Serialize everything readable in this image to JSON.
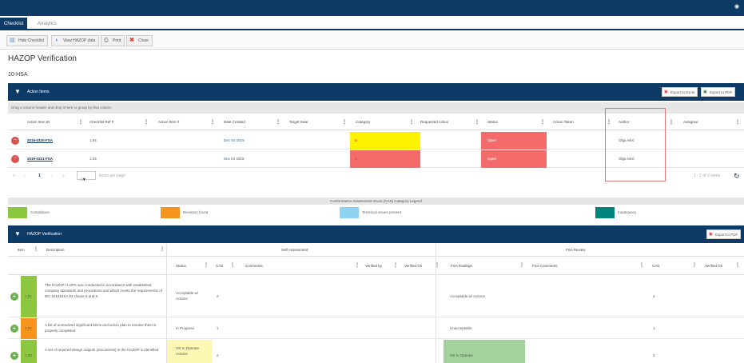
{
  "colors": {
    "navy": "#0e3a66",
    "yellow": "#fdf200",
    "red": "#f36b6b",
    "legend_green": "#8dc63f",
    "legend_orange": "#f7941d",
    "legend_blue": "#8fd3f2",
    "legend_teal": "#00857c",
    "item_green": "#8dc63f",
    "item_orange": "#f7941d",
    "light_yellow": "#fcf8b4",
    "light_green": "#a3d29c"
  },
  "tabs": [
    {
      "label": "Checklist"
    },
    {
      "label": "Analytics"
    }
  ],
  "toolbar": {
    "hide_checklist": "Hide Checklist",
    "view_hazop": "View HAZOP data",
    "print": "Print",
    "close": "Close"
  },
  "page": {
    "title": "HAZOP Verification",
    "subtitle": "10-HSA"
  },
  "action_panel": {
    "title": "Action Items",
    "export_excel": "Export to Excel",
    "export_pdf": "Export to PDF",
    "group_hint": "Drag a column header and drop it here to group by that column",
    "columns": [
      "Action Item ID",
      "Checklist Ref #",
      "Action Item #",
      "Date Created",
      "Target Date",
      "Category",
      "Requested Action",
      "Status",
      "Action Taken",
      "Author",
      "Assignee"
    ],
    "rows": [
      {
        "id": "2019-0320-FSA",
        "checklist_ref": "1.04",
        "date": "Dec 04 2019",
        "category": "B",
        "status": "Open",
        "author": "Olga Ivkić"
      },
      {
        "id": "2019-0321-FSA",
        "checklist_ref": "1.04",
        "date": "Dec 04 2019",
        "category": "A",
        "status": "Open",
        "author": "Olga Ivkić"
      }
    ],
    "pager": {
      "first": "«",
      "prev": "‹",
      "page": "1",
      "next": "›",
      "last": "»",
      "size": "10",
      "per_page": "items per page",
      "count": "1 - 2 of 2 items"
    }
  },
  "legend": {
    "title": "Conformance Assessment Score (CAS) Category Legend",
    "items": [
      {
        "label": "Compliance"
      },
      {
        "label": "Deviation found"
      },
      {
        "label": "Technical issues present"
      },
      {
        "label": "Inadequacy"
      }
    ]
  },
  "hazop_panel": {
    "title": "HAZOP Verification",
    "export_pdf": "Export to PDF",
    "group_self": "Self Assessment",
    "group_fsa": "FSA Review",
    "col_item": "Item",
    "col_description": "Description",
    "sub_cols": [
      "Status",
      "CAS",
      "Comments",
      "Verified by",
      "Verified On",
      "FSA Findings",
      "FSA Comments",
      "CAS",
      "Verified On"
    ],
    "rows": [
      {
        "item": "1.01",
        "description": "The HAZOP / LOPA was conducted in accordance with established company standards and procedures and which meets the requirements of IEC 61511/ISA 84 clause 8 and 9.",
        "status": "Acceptable w/ Actions",
        "cas": "2",
        "fsa_findings": "Acceptable w/ Actions",
        "fsa_cas": "2"
      },
      {
        "item": "1.02",
        "description": "A list of unresolved significant items and action plan to resolve them is properly completed",
        "status": "In Progress",
        "cas": "1",
        "fsa_findings": "Unacceptable",
        "fsa_cas": "1"
      },
      {
        "item": "1.03",
        "description": "A set of required design outputs (documents) in the HAZOP is identified",
        "status": "OK to Operate Actions",
        "cas": "2",
        "fsa_findings": "OK to Operate",
        "fsa_cas": "2"
      }
    ]
  }
}
